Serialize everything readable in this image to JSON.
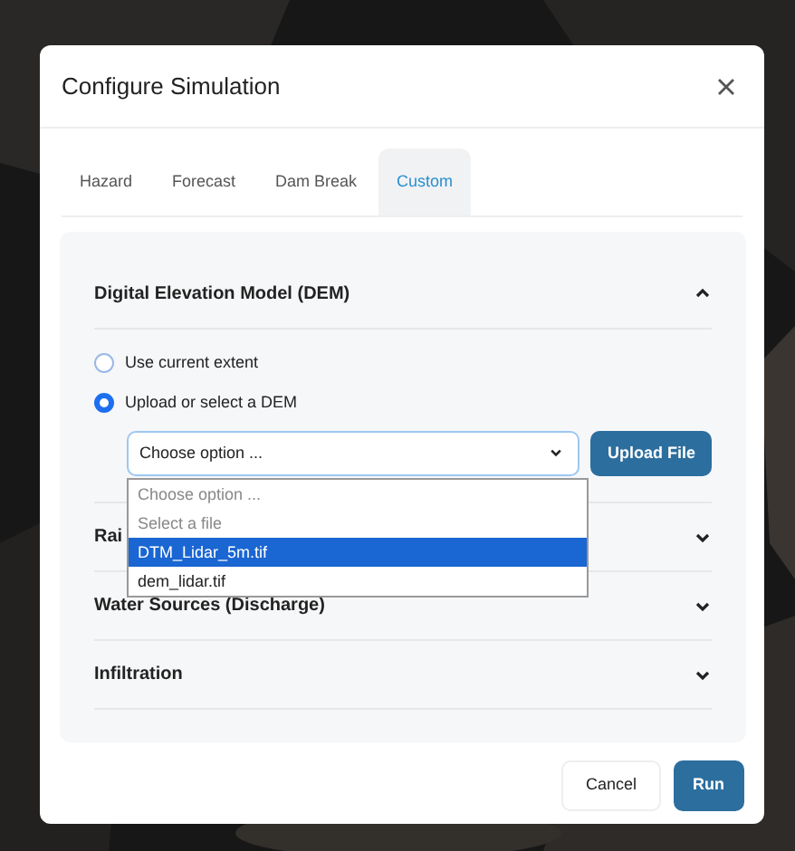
{
  "dialog": {
    "title": "Configure Simulation"
  },
  "tabs": [
    {
      "label": "Hazard",
      "selected": false
    },
    {
      "label": "Forecast",
      "selected": false
    },
    {
      "label": "Dam Break",
      "selected": false
    },
    {
      "label": "Custom",
      "selected": true
    }
  ],
  "sections": [
    {
      "title": "Digital Elevation Model (DEM)",
      "expanded": true,
      "options": [
        {
          "label": "Use current extent",
          "selected": false
        },
        {
          "label": "Upload or select a DEM",
          "selected": true
        }
      ],
      "select": {
        "value": "Choose option ...",
        "open": true,
        "items": [
          {
            "label": "Choose option ...",
            "highlighted": false,
            "disabled": true
          },
          {
            "label": "Select a file",
            "highlighted": false,
            "disabled": true
          },
          {
            "label": "DTM_Lidar_5m.tif",
            "highlighted": true,
            "disabled": false
          },
          {
            "label": "dem_lidar.tif",
            "highlighted": false,
            "disabled": false
          }
        ]
      },
      "upload_button": "Upload File"
    },
    {
      "title": "Rai",
      "expanded": false
    },
    {
      "title": "Water Sources (Discharge)",
      "expanded": false
    },
    {
      "title": "Infiltration",
      "expanded": false
    }
  ],
  "buttons": [
    {
      "label": "Cancel",
      "kind": "secondary"
    },
    {
      "label": "Run",
      "kind": "primary"
    }
  ]
}
